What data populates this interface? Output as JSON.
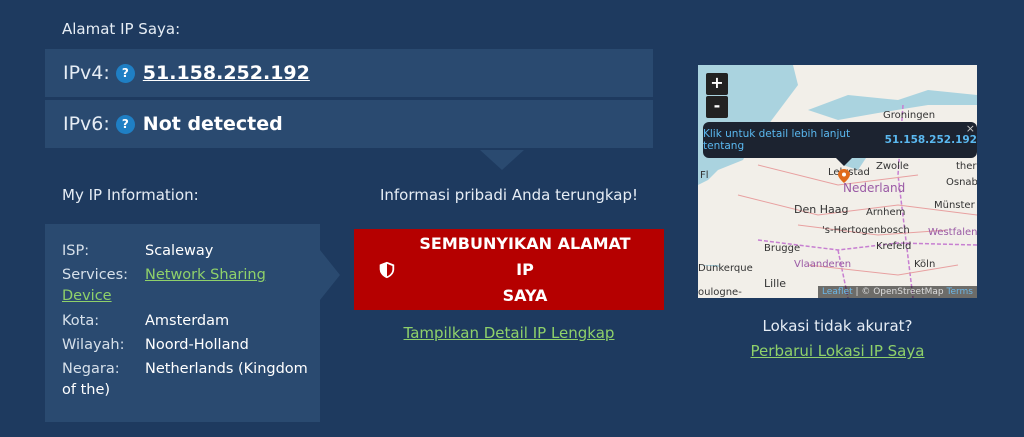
{
  "header": {
    "title": "Alamat IP Saya:"
  },
  "ipv4": {
    "label": "IPv4:",
    "help": "?",
    "value": "51.158.252.192"
  },
  "ipv6": {
    "label": "IPv6:",
    "help": "?",
    "value": "Not detected"
  },
  "info": {
    "title": "My IP Information:",
    "isp_label": "ISP:",
    "isp_value": "Scaleway",
    "services_label": "Services:",
    "services_value_line1": "Network Sharing",
    "services_value_line2": "Device",
    "city_label": "Kota:",
    "city_value": "Amsterdam",
    "region_label": "Wilayah:",
    "region_value": "Noord-Holland",
    "country_label": "Negara:",
    "country_value_line1": "Netherlands (Kingdom",
    "country_value_line2": "of the)"
  },
  "exposed_text": "Informasi pribadi Anda terungkap!",
  "hide_button": {
    "line1": "SEMBUNYIKAN ALAMAT IP",
    "line2": "SAYA",
    "icon": "shield-icon"
  },
  "show_detail_link": "Tampilkan Detail IP Lengkap",
  "map": {
    "zoom_in": "+",
    "zoom_out": "-",
    "tooltip_text": "Klik untuk detail lebih lanjut tentang",
    "tooltip_ip": "51.158.252.192",
    "close": "×",
    "labels": {
      "groningen": "Groningen",
      "zwolle": "Zwolle",
      "nederland": "Nederland",
      "denhaag": "Den Haag",
      "arnhem": "Arnhem",
      "osnabr": "Osnabr",
      "lelystad": "Lelystad",
      "hertogenbosch": "'s-Hertogenbosch",
      "brugge": "Brugge",
      "krefeld": "Krefeld",
      "westfalen": "Westfalen",
      "vlaanderen": "Vlaanderen",
      "koln": "Köln",
      "dunkerque": "Dunkerque",
      "lille": "Lille",
      "boulogne": "oulogne-",
      "ther": "ther",
      "munster": "Münster",
      "fl": "Fl"
    },
    "attribution_leaflet": "Leaflet",
    "attribution_rest": " | © OpenStreetMap",
    "attribution_terms": "Terms"
  },
  "location": {
    "question": "Lokasi tidak akurat?",
    "update_link": "Perbarui Lokasi IP Saya"
  },
  "colors": {
    "background": "#1e3a5f",
    "panel": "#2a4a70",
    "danger": "#b50000",
    "link": "#8fd16a",
    "help": "#1f7fc4"
  }
}
